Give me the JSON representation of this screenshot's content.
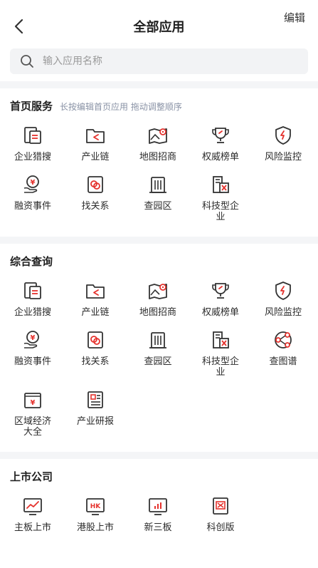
{
  "header": {
    "title": "全部应用",
    "edit_label": "编辑"
  },
  "search": {
    "placeholder": "输入应用名称"
  },
  "sections": [
    {
      "title": "首页服务",
      "hint": "长按编辑首页应用 拖动调整顺序",
      "items": [
        {
          "label": "企业猎搜",
          "icon": "doc-search-icon"
        },
        {
          "label": "产业链",
          "icon": "chain-icon"
        },
        {
          "label": "地图招商",
          "icon": "map-pin-icon"
        },
        {
          "label": "权威榜单",
          "icon": "trophy-icon"
        },
        {
          "label": "风险监控",
          "icon": "shield-icon"
        },
        {
          "label": "融资事件",
          "icon": "yuan-hand-icon"
        },
        {
          "label": "找关系",
          "icon": "relation-icon"
        },
        {
          "label": "查园区",
          "icon": "building-icon"
        },
        {
          "label": "科技型企业",
          "icon": "tech-building-icon"
        }
      ]
    },
    {
      "title": "综合查询",
      "hint": "",
      "items": [
        {
          "label": "企业猎搜",
          "icon": "doc-search-icon"
        },
        {
          "label": "产业链",
          "icon": "chain-icon"
        },
        {
          "label": "地图招商",
          "icon": "map-pin-icon"
        },
        {
          "label": "权威榜单",
          "icon": "trophy-icon"
        },
        {
          "label": "风险监控",
          "icon": "shield-icon"
        },
        {
          "label": "融资事件",
          "icon": "yuan-hand-icon"
        },
        {
          "label": "找关系",
          "icon": "relation-icon"
        },
        {
          "label": "查园区",
          "icon": "building-icon"
        },
        {
          "label": "科技型企业",
          "icon": "tech-building-icon"
        },
        {
          "label": "查图谱",
          "icon": "graph-icon"
        },
        {
          "label": "区域经济大全",
          "icon": "region-economy-icon"
        },
        {
          "label": "产业研报",
          "icon": "report-icon"
        }
      ]
    },
    {
      "title": "上市公司",
      "hint": "",
      "items": [
        {
          "label": "主板上市",
          "icon": "trend-chart-icon"
        },
        {
          "label": "港股上市",
          "icon": "hk-icon"
        },
        {
          "label": "新三板",
          "icon": "bar-chart-icon"
        },
        {
          "label": "科创版",
          "icon": "star-market-icon"
        }
      ]
    }
  ],
  "colors": {
    "accent": "#e5322d",
    "icon_stroke": "#333333",
    "divider": "#f4f5f7",
    "hint": "#8a93a6"
  }
}
